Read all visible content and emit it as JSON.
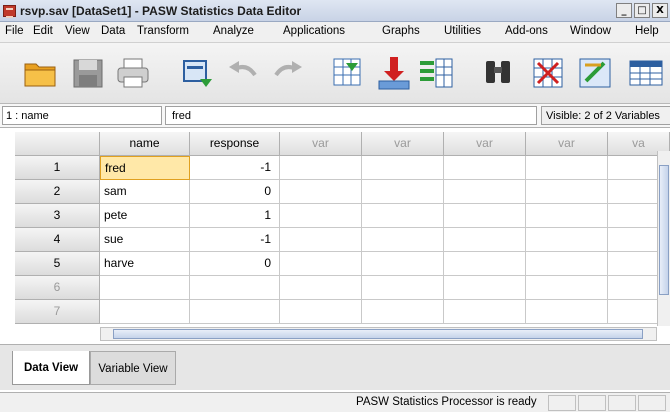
{
  "window": {
    "title": "rsvp.sav [DataSet1] - PASW Statistics Data Editor",
    "min": "_",
    "restore": "□",
    "close": "X"
  },
  "menu": [
    "File",
    "Edit",
    "View",
    "Data",
    "Transform",
    "Analyze",
    "Applications",
    "Graphs",
    "Utilities",
    "Add-ons",
    "Window",
    "Help"
  ],
  "cellbar": {
    "ref": "1 : name",
    "value": "fred",
    "visible": "Visible: 2 of 2 Variables"
  },
  "grid": {
    "columns": [
      "name",
      "response",
      "var",
      "var",
      "var",
      "var",
      "va"
    ],
    "row_numbers": [
      "1",
      "2",
      "3",
      "4",
      "5",
      "6",
      "7"
    ],
    "rows": [
      {
        "name": "fred",
        "response": "-1"
      },
      {
        "name": "sam",
        "response": "0"
      },
      {
        "name": "pete",
        "response": "1"
      },
      {
        "name": "sue",
        "response": "-1"
      },
      {
        "name": "harve",
        "response": "0"
      }
    ]
  },
  "tabs": {
    "data_view": "Data View",
    "variable_view": "Variable View"
  },
  "status": "PASW Statistics Processor is ready"
}
